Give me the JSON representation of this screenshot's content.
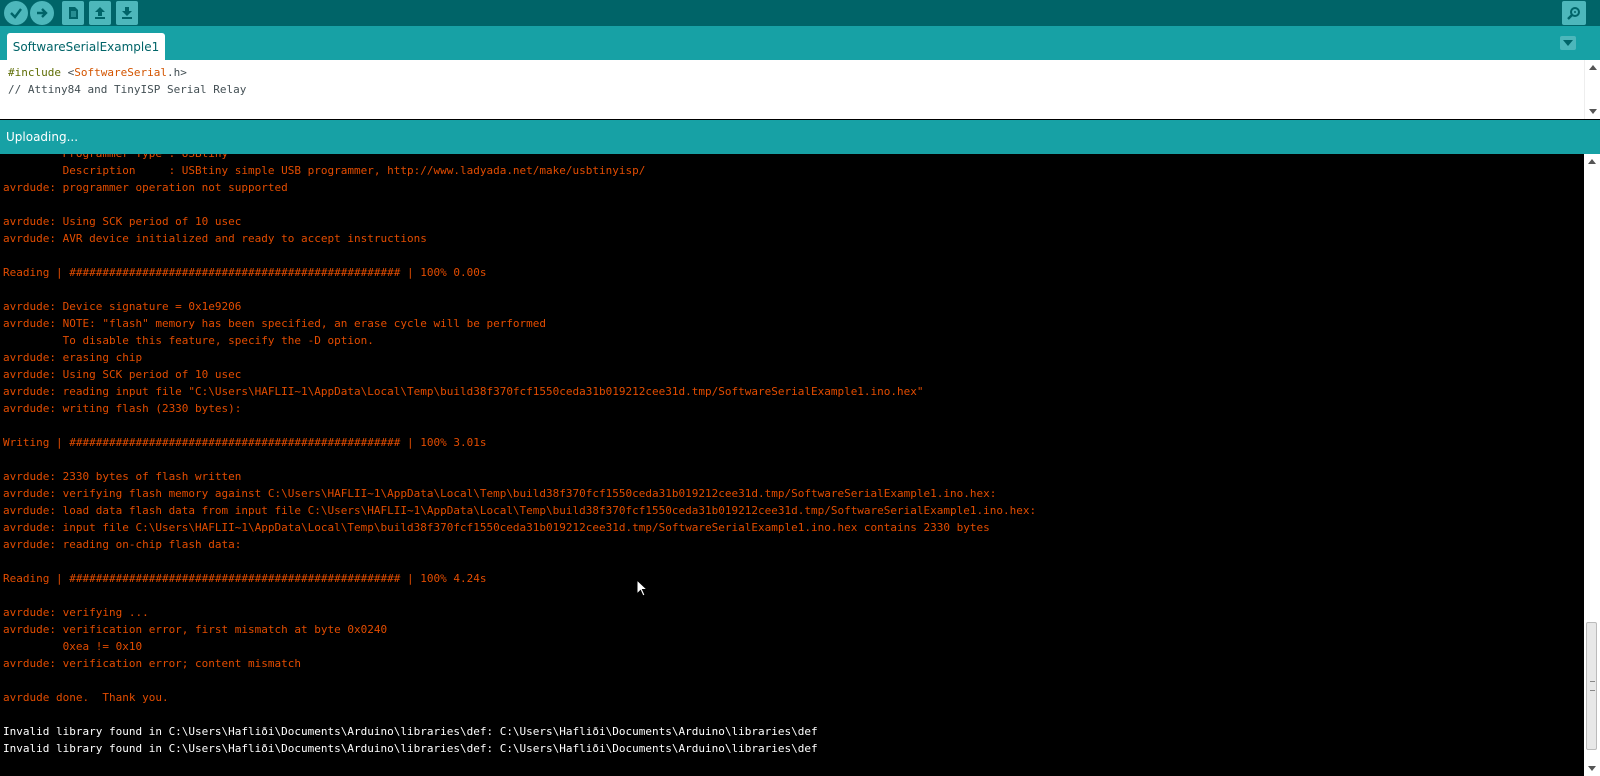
{
  "toolbar": {
    "verify_icon": "check-icon",
    "upload_icon": "arrow-right-icon",
    "new_icon": "new-file-icon",
    "open_icon": "open-upload-icon",
    "save_icon": "save-download-icon",
    "serial_monitor_icon": "serial-monitor-icon"
  },
  "tabs": [
    {
      "label": "SoftwareSerialExample1"
    }
  ],
  "editor": {
    "line1_include": "#include",
    "line1_lt": " <",
    "line1_lib": "SoftwareSerial",
    "line1_rest": ".h>",
    "line2": "// Attiny84 and TinyISP Serial Relay"
  },
  "status": {
    "message": "Uploading..."
  },
  "console": {
    "lines": [
      {
        "text": "         Programmer Type : USBtiny",
        "kind": "err"
      },
      {
        "text": "         Description     : USBtiny simple USB programmer, http://www.ladyada.net/make/usbtinyisp/",
        "kind": "err"
      },
      {
        "text": "avrdude: programmer operation not supported",
        "kind": "err"
      },
      {
        "text": "",
        "kind": "err"
      },
      {
        "text": "avrdude: Using SCK period of 10 usec",
        "kind": "err"
      },
      {
        "text": "avrdude: AVR device initialized and ready to accept instructions",
        "kind": "err"
      },
      {
        "text": "",
        "kind": "err"
      },
      {
        "text": "Reading | ################################################## | 100% 0.00s",
        "kind": "err"
      },
      {
        "text": "",
        "kind": "err"
      },
      {
        "text": "avrdude: Device signature = 0x1e9206",
        "kind": "err"
      },
      {
        "text": "avrdude: NOTE: \"flash\" memory has been specified, an erase cycle will be performed",
        "kind": "err"
      },
      {
        "text": "         To disable this feature, specify the -D option.",
        "kind": "err"
      },
      {
        "text": "avrdude: erasing chip",
        "kind": "err"
      },
      {
        "text": "avrdude: Using SCK period of 10 usec",
        "kind": "err"
      },
      {
        "text": "avrdude: reading input file \"C:\\Users\\HAFLII~1\\AppData\\Local\\Temp\\build38f370fcf1550ceda31b019212cee31d.tmp/SoftwareSerialExample1.ino.hex\"",
        "kind": "err"
      },
      {
        "text": "avrdude: writing flash (2330 bytes):",
        "kind": "err"
      },
      {
        "text": "",
        "kind": "err"
      },
      {
        "text": "Writing | ################################################## | 100% 3.01s",
        "kind": "err"
      },
      {
        "text": "",
        "kind": "err"
      },
      {
        "text": "avrdude: 2330 bytes of flash written",
        "kind": "err"
      },
      {
        "text": "avrdude: verifying flash memory against C:\\Users\\HAFLII~1\\AppData\\Local\\Temp\\build38f370fcf1550ceda31b019212cee31d.tmp/SoftwareSerialExample1.ino.hex:",
        "kind": "err"
      },
      {
        "text": "avrdude: load data flash data from input file C:\\Users\\HAFLII~1\\AppData\\Local\\Temp\\build38f370fcf1550ceda31b019212cee31d.tmp/SoftwareSerialExample1.ino.hex:",
        "kind": "err"
      },
      {
        "text": "avrdude: input file C:\\Users\\HAFLII~1\\AppData\\Local\\Temp\\build38f370fcf1550ceda31b019212cee31d.tmp/SoftwareSerialExample1.ino.hex contains 2330 bytes",
        "kind": "err"
      },
      {
        "text": "avrdude: reading on-chip flash data:",
        "kind": "err"
      },
      {
        "text": "",
        "kind": "err"
      },
      {
        "text": "Reading | ################################################## | 100% 4.24s",
        "kind": "err"
      },
      {
        "text": "",
        "kind": "err"
      },
      {
        "text": "avrdude: verifying ...",
        "kind": "err"
      },
      {
        "text": "avrdude: verification error, first mismatch at byte 0x0240",
        "kind": "err"
      },
      {
        "text": "         0xea != 0x10",
        "kind": "err"
      },
      {
        "text": "avrdude: verification error; content mismatch",
        "kind": "err"
      },
      {
        "text": "",
        "kind": "err"
      },
      {
        "text": "avrdude done.  Thank you.",
        "kind": "err"
      },
      {
        "text": "",
        "kind": "err"
      },
      {
        "text": "Invalid library found in C:\\Users\\Hafliði\\Documents\\Arduino\\libraries\\def: C:\\Users\\Hafliði\\Documents\\Arduino\\libraries\\def",
        "kind": "info"
      },
      {
        "text": "Invalid library found in C:\\Users\\Hafliði\\Documents\\Arduino\\libraries\\def: C:\\Users\\Hafliði\\Documents\\Arduino\\libraries\\def",
        "kind": "info"
      }
    ]
  },
  "colors": {
    "toolbar_bg": "#006468",
    "tabbar_bg": "#17a1a5",
    "console_error_text": "#e34c00",
    "console_info_text": "#ffffff"
  }
}
